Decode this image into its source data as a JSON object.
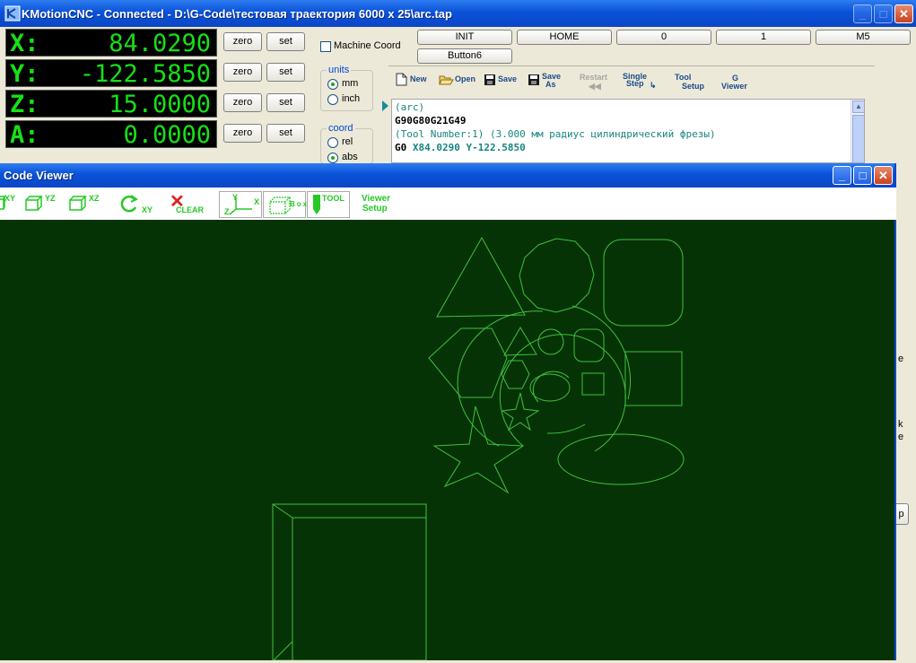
{
  "app": {
    "title": "KMotionCNC - Connected - D:\\G-Code\\тестовая траектория 6000 x 25\\arc.tap",
    "icon": "kmotion-app-icon"
  },
  "dro": [
    {
      "axis": "X:",
      "value": "84.0290",
      "zero": "zero",
      "set": "set"
    },
    {
      "axis": "Y:",
      "value": "-122.5850",
      "zero": "zero",
      "set": "set"
    },
    {
      "axis": "Z:",
      "value": "15.0000",
      "zero": "zero",
      "set": "set"
    },
    {
      "axis": "A:",
      "value": "0.0000",
      "zero": "zero",
      "set": "set"
    }
  ],
  "machine_coord": {
    "label": "Machine Coord",
    "checked": false
  },
  "units": {
    "title": "units",
    "options": [
      "mm",
      "inch"
    ],
    "selected": "mm"
  },
  "coord": {
    "title": "coord",
    "options": [
      "rel",
      "abs"
    ],
    "selected": "abs"
  },
  "user_buttons": [
    "INIT",
    "HOME",
    "0",
    "1",
    "M5",
    "Button6"
  ],
  "toolbar": {
    "new": "New",
    "open": "Open",
    "save": "Save",
    "save_as_1": "Save",
    "save_as_2": "As",
    "restart": "Restart",
    "single_step_1": "Single",
    "single_step_2": "Step",
    "tool_setup_1": "Tool",
    "tool_setup_2": "Setup",
    "g_viewer_1": "G",
    "g_viewer_2": "Viewer"
  },
  "gcode": {
    "line1": "(arc)",
    "line2": "G90G80G21G49",
    "line3": "(Tool Number:1) (3.000 мм радиус цилиндрический фрезы)",
    "line4_cmd": "G0",
    "line4_args": "X84.0290 Y-122.5850"
  },
  "code_viewer": {
    "title": "Code Viewer",
    "tools": {
      "xy": "XY",
      "yz": "YZ",
      "xz": "XZ",
      "rotate": "XY",
      "clear": "CLEAR",
      "box": "Box",
      "tool": "TOOL",
      "viewer_setup_1": "Viewer",
      "viewer_setup_2": "Setup",
      "axes_y": "Y",
      "axes_x": "X",
      "axes_z": "Z"
    },
    "colors": {
      "background": "#063306",
      "toolpath": "#3fbf3f",
      "ui_green": "#25c825"
    }
  },
  "window_controls": {
    "minimize": "_",
    "maximize": "□",
    "close": "✕"
  },
  "partial_right_labels": [
    "e",
    "k",
    "e",
    "p"
  ]
}
